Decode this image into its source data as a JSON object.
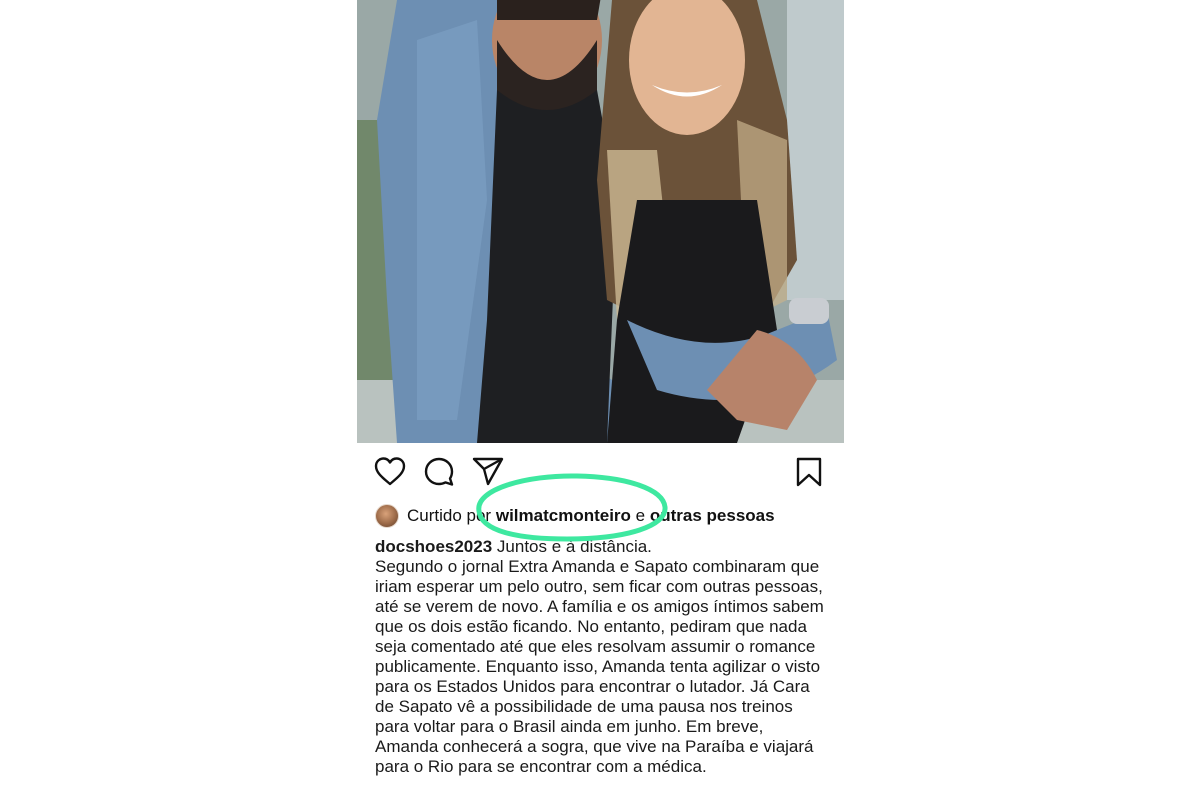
{
  "likes": {
    "prefix": "Curtido por",
    "user": "wilmatcmonteiro",
    "connector": "e",
    "others": "outras pessoas"
  },
  "caption": {
    "username": "docshoes2023",
    "headline": "Juntos e à distância.",
    "body": "Segundo o jornal Extra Amanda e Sapato combinaram que iriam esperar um pelo outro, sem ficar com outras pessoas, até se verem de novo. A família e os amigos íntimos sabem que os dois estão ficando. No entanto, pediram que nada seja comentado até que eles resolvam assumir o romance publicamente. Enquanto isso, Amanda tenta agilizar o visto para os Estados Unidos para encontrar o lutador. Já Cara de Sapato vê a possibilidade de uma pausa nos treinos para voltar para o Brasil ainda em junho. Em breve, Amanda conhecerá a sogra, que vive na Paraíba e viajará para o Rio para se encontrar com a médica."
  },
  "icons": {
    "like": "heart-icon",
    "comment": "comment-bubble-icon",
    "share": "paper-plane-icon",
    "save": "bookmark-icon"
  },
  "colors": {
    "highlight": "#3ee8a0",
    "text": "#111111"
  }
}
